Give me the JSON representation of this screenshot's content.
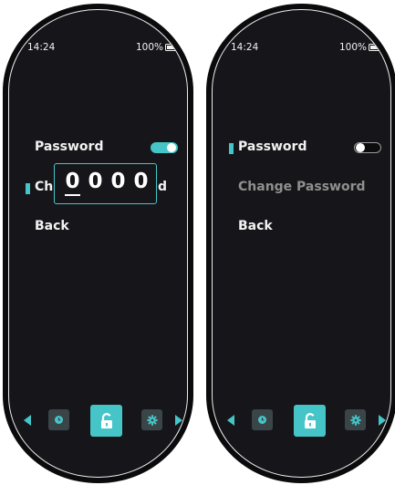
{
  "left_screen": {
    "status": {
      "time": "14:24",
      "battery": "100%"
    },
    "menu": {
      "password_label": "Password",
      "change_password_partial_left": "Ch",
      "change_password_partial_right": "d",
      "back_label": "Back"
    },
    "password_toggle": "on",
    "pin_digits": [
      "0",
      "0",
      "0",
      "0"
    ]
  },
  "right_screen": {
    "status": {
      "time": "14:24",
      "battery": "100%"
    },
    "menu": {
      "password_label": "Password",
      "change_password_label": "Change Password",
      "back_label": "Back"
    },
    "password_toggle": "off"
  },
  "bottom_nav": {
    "icons": [
      "clock-icon",
      "unlock-icon",
      "gear-icon"
    ],
    "active": "unlock-icon"
  },
  "colors": {
    "accent": "#45c5c8",
    "background": "#16161a",
    "text": "#f2f2f2",
    "dimmed_text": "#8f8f8f"
  }
}
